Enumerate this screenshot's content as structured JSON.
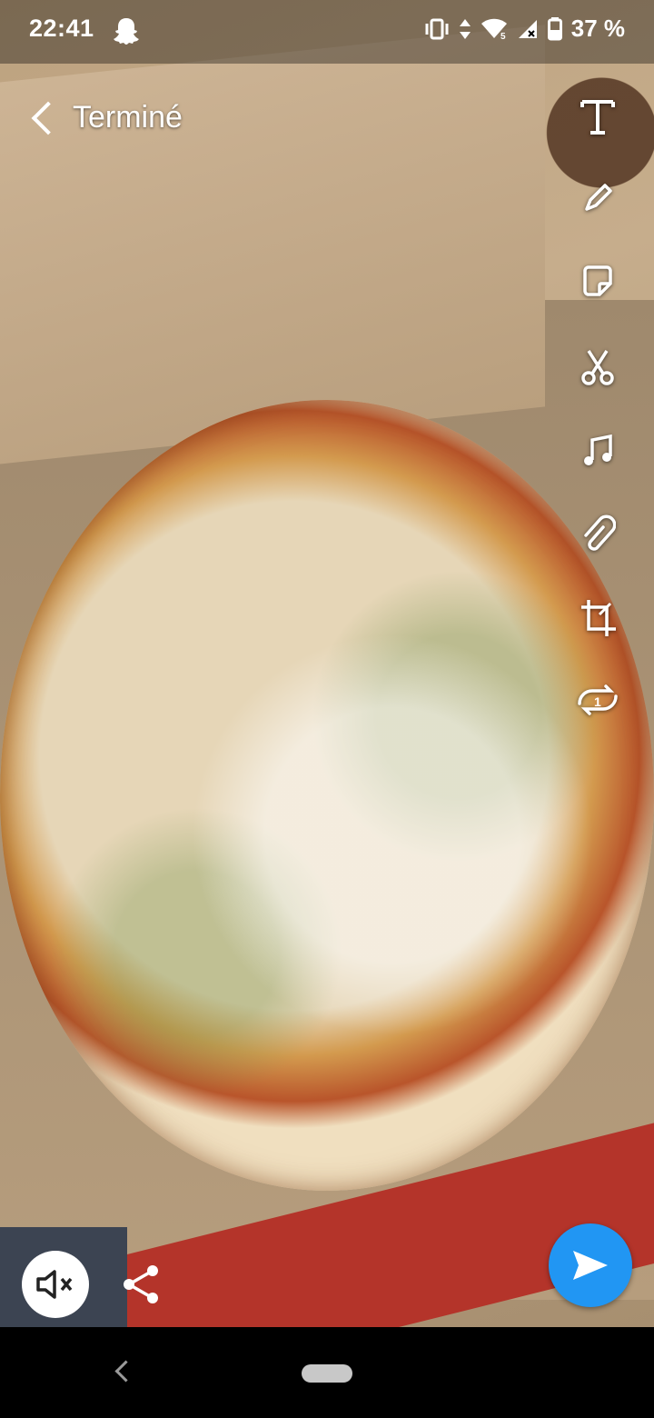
{
  "status_bar": {
    "time": "22:41",
    "battery_text": "37 %",
    "icons": [
      "snapchat-ghost-icon",
      "vibrate-icon",
      "data-arrows-icon",
      "wifi-icon",
      "signal-icon",
      "battery-icon"
    ]
  },
  "top_bar": {
    "back_label": "Terminé"
  },
  "toolbar": {
    "tools": [
      "text-tool-icon",
      "pencil-tool-icon",
      "sticker-tool-icon",
      "scissors-tool-icon",
      "music-tool-icon",
      "paperclip-tool-icon",
      "crop-tool-icon",
      "loop-tool-icon"
    ],
    "loop_badge": "1"
  },
  "bottom": {
    "mute_icon": "sound-off-icon",
    "share_icon": "share-icon",
    "send_icon": "send-arrow-icon",
    "send_color": "#2196f3"
  },
  "nav": {
    "icons": [
      "nav-back-icon",
      "nav-home-pill"
    ]
  }
}
